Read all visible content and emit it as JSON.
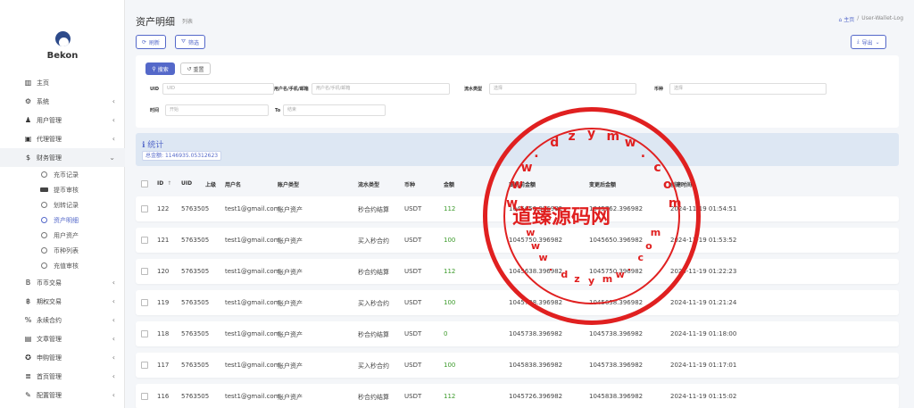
{
  "brand": {
    "name": "Bekon"
  },
  "sidebar": {
    "items": [
      {
        "label": "主页",
        "icon": "chart-bar-icon",
        "glyph": "▥",
        "chevron": ""
      },
      {
        "label": "系统",
        "icon": "gear-icon",
        "glyph": "⚙",
        "chevron": "‹"
      },
      {
        "label": "用户管理",
        "icon": "user-icon",
        "glyph": "♟",
        "chevron": "‹"
      },
      {
        "label": "代理管理",
        "icon": "id-card-icon",
        "glyph": "▣",
        "chevron": "‹"
      },
      {
        "label": "财务管理",
        "icon": "dollar-icon",
        "glyph": "$",
        "chevron": "⌄"
      }
    ],
    "sub_items": [
      {
        "label": "充币记录",
        "type": "circle"
      },
      {
        "label": "提币审核",
        "type": "card"
      },
      {
        "label": "划转记录",
        "type": "circle"
      },
      {
        "label": "资产明细",
        "type": "circle",
        "active": true
      },
      {
        "label": "用户资产",
        "type": "circle"
      },
      {
        "label": "币种列表",
        "type": "circle"
      },
      {
        "label": "充值审核",
        "type": "circle"
      }
    ],
    "items_after": [
      {
        "label": "币币交易",
        "icon": "bitcoin-b-icon",
        "glyph": "B",
        "chevron": "‹"
      },
      {
        "label": "期权交易",
        "icon": "bitcoin-icon",
        "glyph": "฿",
        "chevron": "‹"
      },
      {
        "label": "永续合约",
        "icon": "percent-icon",
        "glyph": "%",
        "chevron": "‹"
      },
      {
        "label": "文章管理",
        "icon": "newspaper-icon",
        "glyph": "▤",
        "chevron": "‹"
      },
      {
        "label": "申购管理",
        "icon": "life-ring-icon",
        "glyph": "✪",
        "chevron": "‹"
      },
      {
        "label": "首页管理",
        "icon": "list-icon",
        "glyph": "≣",
        "chevron": "‹"
      },
      {
        "label": "配置管理",
        "icon": "wrench-icon",
        "glyph": "✎",
        "chevron": "‹"
      }
    ]
  },
  "header": {
    "title": "资产明细",
    "subtitle": "列表",
    "breadcrumb_home": "主页",
    "breadcrumb_sep": "/",
    "breadcrumb_current": "User-Wallet-Log"
  },
  "toolbar": {
    "refresh": "刷新",
    "filter": "筛选",
    "export": "导出",
    "refresh_icon": "⟳",
    "filter_icon": "⛛",
    "export_icon": "⤓",
    "export_caret": "⌄"
  },
  "filters": {
    "search_btn": "搜索",
    "reset_btn": "重置",
    "search_icon": "⚲",
    "reset_icon": "↺",
    "uid_label": "UID",
    "uid_placeholder": "UID",
    "user_label": "用户名/手机/邮箱",
    "user_placeholder": "用户名/手机/邮箱",
    "flow_label": "流水类型",
    "flow_placeholder": "选择",
    "coin_label": "币种",
    "coin_placeholder": "选择",
    "time_label": "时间",
    "time_from": "开始",
    "time_to_label": "To",
    "time_to": "结束"
  },
  "stats": {
    "title": "统计",
    "title_icon": "ℹ",
    "total_label": "总金额:",
    "total_value": "1146935.05312623"
  },
  "table": {
    "headers": [
      "ID",
      "UID",
      "上级",
      "用户名",
      "账户类型",
      "流水类型",
      "币种",
      "金额",
      "变更前金额",
      "变更后金额",
      "创建时间"
    ],
    "sort_icon": "↑",
    "rows": [
      {
        "id": "122",
        "uid": "5763505",
        "parent": "",
        "user": "test1@gmail.com",
        "account": "账户资产",
        "flow": "秒合约结算",
        "coin": "USDT",
        "amount": "112",
        "before": "1045650.396982",
        "after": "1045762.396982",
        "time": "2024-11-19 01:54:51"
      },
      {
        "id": "121",
        "uid": "5763505",
        "parent": "",
        "user": "test1@gmail.com",
        "account": "账户资产",
        "flow": "买入秒合约",
        "coin": "USDT",
        "amount": "100",
        "before": "1045750.396982",
        "after": "1045650.396982",
        "time": "2024-11-19 01:53:52"
      },
      {
        "id": "120",
        "uid": "5763505",
        "parent": "",
        "user": "test1@gmail.com",
        "account": "账户资产",
        "flow": "秒合约结算",
        "coin": "USDT",
        "amount": "112",
        "before": "1045638.396982",
        "after": "1045750.396982",
        "time": "2024-11-19 01:22:23"
      },
      {
        "id": "119",
        "uid": "5763505",
        "parent": "",
        "user": "test1@gmail.com",
        "account": "账户资产",
        "flow": "买入秒合约",
        "coin": "USDT",
        "amount": "100",
        "before": "1045738.396982",
        "after": "1045638.396982",
        "time": "2024-11-19 01:21:24"
      },
      {
        "id": "118",
        "uid": "5763505",
        "parent": "",
        "user": "test1@gmail.com",
        "account": "账户资产",
        "flow": "秒合约结算",
        "coin": "USDT",
        "amount": "0",
        "before": "1045738.396982",
        "after": "1045738.396982",
        "time": "2024-11-19 01:18:00"
      },
      {
        "id": "117",
        "uid": "5763505",
        "parent": "",
        "user": "test1@gmail.com",
        "account": "账户资产",
        "flow": "买入秒合约",
        "coin": "USDT",
        "amount": "100",
        "before": "1045838.396982",
        "after": "1045738.396982",
        "time": "2024-11-19 01:17:01"
      },
      {
        "id": "116",
        "uid": "5763505",
        "parent": "",
        "user": "test1@gmail.com",
        "account": "账户资产",
        "flow": "秒合约结算",
        "coin": "USDT",
        "amount": "112",
        "before": "1045726.396982",
        "after": "1045838.396982",
        "time": "2024-11-19 01:15:02"
      }
    ]
  },
  "watermark": {
    "text": "道臻源码网",
    "ring_chars": [
      "w",
      "w",
      "w",
      ".",
      "d",
      "z",
      "y",
      "m",
      "w",
      ".",
      "c",
      "o",
      "m"
    ],
    "ring_chars_bottom": [
      "w",
      "w",
      "w",
      ".",
      "d",
      "z",
      "y",
      "m",
      "w",
      ".",
      "c",
      "o",
      "m"
    ]
  },
  "colors": {
    "accent": "#5468c9",
    "positive": "#3c9a2b",
    "stamp": "#e02020"
  }
}
